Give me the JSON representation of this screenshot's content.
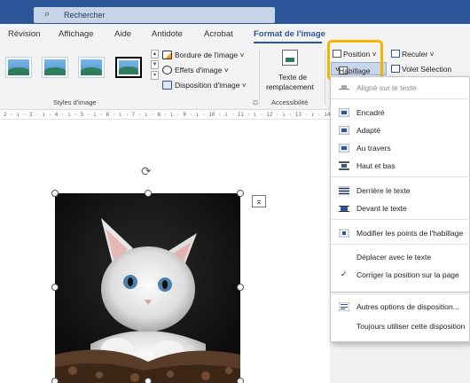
{
  "titlebar": {
    "search_icon": "search-icon",
    "search_placeholder": "Rechercher"
  },
  "tabs": [
    "Révision",
    "Affichage",
    "Aide",
    "Antidote",
    "Acrobat",
    "Format de l'image"
  ],
  "ribbon": {
    "styles_group_label": "Styles d'image",
    "bordure": "Bordure de l'image",
    "effets": "Effets d'image",
    "disposition": "Disposition d'image",
    "alt_text_line1": "Texte de",
    "alt_text_line2": "remplacement",
    "accessibilite": "Accessibilité",
    "position": "Position",
    "habillage": "Habillage",
    "reculer": "Reculer",
    "volet": "Volet Sélection"
  },
  "ruler_text": "2 · ı · 3 · ı · 4 · ı · 5 · ı · 6 · ı · 7 · ı · 8 · ı · 9 · ı · 10 · ı · 11 · ı · 12 · ı · 13 · ı · 14 · ı ·",
  "menu": {
    "items": [
      {
        "label": "Aligné sur le texte",
        "icon": "inline-wrap-icon"
      },
      {
        "label": "Encadré",
        "icon": "square-wrap-icon"
      },
      {
        "label": "Adapté",
        "icon": "tight-wrap-icon"
      },
      {
        "label": "Au travers",
        "icon": "through-wrap-icon"
      },
      {
        "label": "Haut et bas",
        "icon": "top-bottom-wrap-icon"
      },
      {
        "label": "Derrière le texte",
        "icon": "behind-text-icon"
      },
      {
        "label": "Devant le texte",
        "icon": "in-front-text-icon"
      },
      {
        "label": "Modifier les points de l'habillage",
        "icon": "edit-wrap-points-icon"
      },
      {
        "label": "Déplacer avec le texte",
        "icon": ""
      },
      {
        "label": "Corriger la position sur la page",
        "icon": "checkmark-icon"
      },
      {
        "label": "Autres options de disposition...",
        "icon": "layout-options-icon"
      },
      {
        "label": "Toujours utiliser cette disposition",
        "icon": ""
      }
    ]
  },
  "colors": {
    "titlebar": "#2b579a",
    "accent": "#2b579a",
    "highlight": "#f7b500"
  }
}
